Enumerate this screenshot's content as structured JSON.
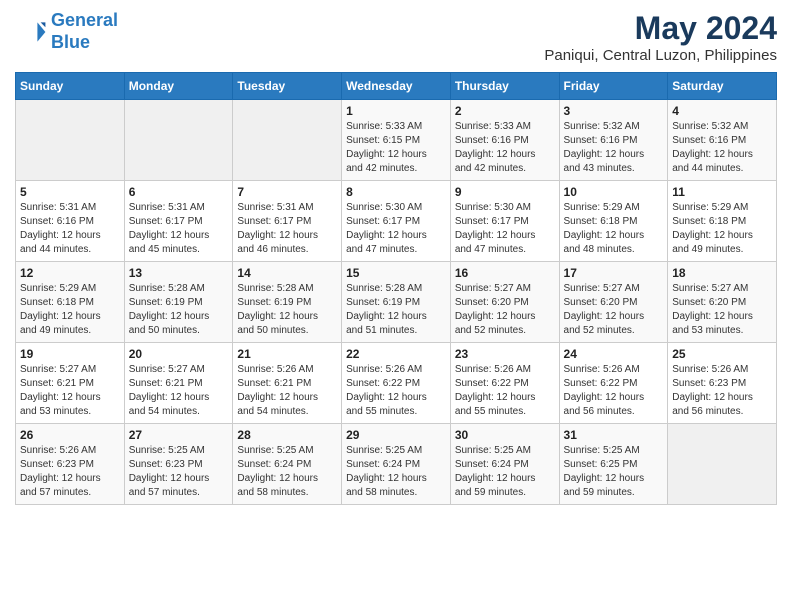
{
  "header": {
    "logo_line1": "General",
    "logo_line2": "Blue",
    "title": "May 2024",
    "subtitle": "Paniqui, Central Luzon, Philippines"
  },
  "calendar": {
    "days_of_week": [
      "Sunday",
      "Monday",
      "Tuesday",
      "Wednesday",
      "Thursday",
      "Friday",
      "Saturday"
    ],
    "weeks": [
      {
        "days": [
          {
            "number": "",
            "info": ""
          },
          {
            "number": "",
            "info": ""
          },
          {
            "number": "",
            "info": ""
          },
          {
            "number": "1",
            "info": "Sunrise: 5:33 AM\nSunset: 6:15 PM\nDaylight: 12 hours\nand 42 minutes."
          },
          {
            "number": "2",
            "info": "Sunrise: 5:33 AM\nSunset: 6:16 PM\nDaylight: 12 hours\nand 42 minutes."
          },
          {
            "number": "3",
            "info": "Sunrise: 5:32 AM\nSunset: 6:16 PM\nDaylight: 12 hours\nand 43 minutes."
          },
          {
            "number": "4",
            "info": "Sunrise: 5:32 AM\nSunset: 6:16 PM\nDaylight: 12 hours\nand 44 minutes."
          }
        ]
      },
      {
        "days": [
          {
            "number": "5",
            "info": "Sunrise: 5:31 AM\nSunset: 6:16 PM\nDaylight: 12 hours\nand 44 minutes."
          },
          {
            "number": "6",
            "info": "Sunrise: 5:31 AM\nSunset: 6:17 PM\nDaylight: 12 hours\nand 45 minutes."
          },
          {
            "number": "7",
            "info": "Sunrise: 5:31 AM\nSunset: 6:17 PM\nDaylight: 12 hours\nand 46 minutes."
          },
          {
            "number": "8",
            "info": "Sunrise: 5:30 AM\nSunset: 6:17 PM\nDaylight: 12 hours\nand 47 minutes."
          },
          {
            "number": "9",
            "info": "Sunrise: 5:30 AM\nSunset: 6:17 PM\nDaylight: 12 hours\nand 47 minutes."
          },
          {
            "number": "10",
            "info": "Sunrise: 5:29 AM\nSunset: 6:18 PM\nDaylight: 12 hours\nand 48 minutes."
          },
          {
            "number": "11",
            "info": "Sunrise: 5:29 AM\nSunset: 6:18 PM\nDaylight: 12 hours\nand 49 minutes."
          }
        ]
      },
      {
        "days": [
          {
            "number": "12",
            "info": "Sunrise: 5:29 AM\nSunset: 6:18 PM\nDaylight: 12 hours\nand 49 minutes."
          },
          {
            "number": "13",
            "info": "Sunrise: 5:28 AM\nSunset: 6:19 PM\nDaylight: 12 hours\nand 50 minutes."
          },
          {
            "number": "14",
            "info": "Sunrise: 5:28 AM\nSunset: 6:19 PM\nDaylight: 12 hours\nand 50 minutes."
          },
          {
            "number": "15",
            "info": "Sunrise: 5:28 AM\nSunset: 6:19 PM\nDaylight: 12 hours\nand 51 minutes."
          },
          {
            "number": "16",
            "info": "Sunrise: 5:27 AM\nSunset: 6:20 PM\nDaylight: 12 hours\nand 52 minutes."
          },
          {
            "number": "17",
            "info": "Sunrise: 5:27 AM\nSunset: 6:20 PM\nDaylight: 12 hours\nand 52 minutes."
          },
          {
            "number": "18",
            "info": "Sunrise: 5:27 AM\nSunset: 6:20 PM\nDaylight: 12 hours\nand 53 minutes."
          }
        ]
      },
      {
        "days": [
          {
            "number": "19",
            "info": "Sunrise: 5:27 AM\nSunset: 6:21 PM\nDaylight: 12 hours\nand 53 minutes."
          },
          {
            "number": "20",
            "info": "Sunrise: 5:27 AM\nSunset: 6:21 PM\nDaylight: 12 hours\nand 54 minutes."
          },
          {
            "number": "21",
            "info": "Sunrise: 5:26 AM\nSunset: 6:21 PM\nDaylight: 12 hours\nand 54 minutes."
          },
          {
            "number": "22",
            "info": "Sunrise: 5:26 AM\nSunset: 6:22 PM\nDaylight: 12 hours\nand 55 minutes."
          },
          {
            "number": "23",
            "info": "Sunrise: 5:26 AM\nSunset: 6:22 PM\nDaylight: 12 hours\nand 55 minutes."
          },
          {
            "number": "24",
            "info": "Sunrise: 5:26 AM\nSunset: 6:22 PM\nDaylight: 12 hours\nand 56 minutes."
          },
          {
            "number": "25",
            "info": "Sunrise: 5:26 AM\nSunset: 6:23 PM\nDaylight: 12 hours\nand 56 minutes."
          }
        ]
      },
      {
        "days": [
          {
            "number": "26",
            "info": "Sunrise: 5:26 AM\nSunset: 6:23 PM\nDaylight: 12 hours\nand 57 minutes."
          },
          {
            "number": "27",
            "info": "Sunrise: 5:25 AM\nSunset: 6:23 PM\nDaylight: 12 hours\nand 57 minutes."
          },
          {
            "number": "28",
            "info": "Sunrise: 5:25 AM\nSunset: 6:24 PM\nDaylight: 12 hours\nand 58 minutes."
          },
          {
            "number": "29",
            "info": "Sunrise: 5:25 AM\nSunset: 6:24 PM\nDaylight: 12 hours\nand 58 minutes."
          },
          {
            "number": "30",
            "info": "Sunrise: 5:25 AM\nSunset: 6:24 PM\nDaylight: 12 hours\nand 59 minutes."
          },
          {
            "number": "31",
            "info": "Sunrise: 5:25 AM\nSunset: 6:25 PM\nDaylight: 12 hours\nand 59 minutes."
          },
          {
            "number": "",
            "info": ""
          }
        ]
      }
    ]
  }
}
